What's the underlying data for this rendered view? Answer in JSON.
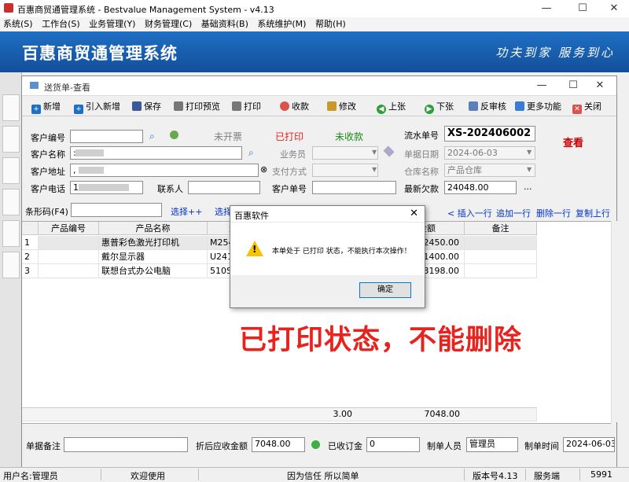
{
  "outer_window": {
    "title": "百惠商贸通管理系统 - Bestvalue Management System - v4.13",
    "minimize": "—",
    "maximize": "☐",
    "close": "✕"
  },
  "menubar": [
    "系统(S)",
    "工作台(S)",
    "业务管理(Y)",
    "财务管理(C)",
    "基础资料(B)",
    "系统维护(M)",
    "帮助(H)"
  ],
  "banner": {
    "app_name": "百惠商贸通管理系统",
    "slogan": "功夫到家 服务到心"
  },
  "inner_window": {
    "title": "送货单-查看",
    "minimize": "—",
    "maximize": "☐",
    "close": "✕"
  },
  "toolbar": {
    "new": "新增",
    "import_new": "引入新增",
    "save": "保存",
    "print_preview": "打印预览",
    "print": "打印",
    "collect": "收款",
    "modify": "修改",
    "prev": "上张",
    "next": "下张",
    "unaudit": "反审核",
    "more": "更多功能",
    "close": "关闭"
  },
  "form": {
    "customer_code_label": "客户编号",
    "customer_code": "",
    "invoice_status": "未开票",
    "print_status": "已打印",
    "collect_status": "未收款",
    "serial_label": "流水单号",
    "serial": "XS-202406002",
    "mode": "查看",
    "customer_name_label": "客户名称",
    "customer_name": ":",
    "salesman_label": "业务员",
    "salesman": "",
    "date_label": "单据日期",
    "date": "2024-06-03",
    "address_label": "客户地址",
    "address": ",",
    "pay_label": "支付方式",
    "pay": "",
    "warehouse_label": "仓库名称",
    "warehouse": "产品仓库",
    "phone_label": "客户电话",
    "phone": "1",
    "contact_label": "联系人",
    "contact": "",
    "cust_order_label": "客户单号",
    "cust_order": "",
    "debt_label": "最新欠款",
    "debt": "24048.00",
    "more_dots": "..."
  },
  "barcode_bar": {
    "label": "条形码(F4)",
    "select": "选择++",
    "select_product": "选择产",
    "insert_row": "< 插入一行",
    "append_row": "追加一行",
    "delete_row": "删除一行",
    "copy_row": "复制上行"
  },
  "grid": {
    "headers": [
      "产品编号",
      "产品名称",
      "型号",
      "金额",
      "备注"
    ],
    "rows": [
      {
        "no": "1",
        "code": "",
        "name": "惠普彩色激光打印机",
        "model": "M254",
        "amount": "2450.00"
      },
      {
        "no": "2",
        "code": "",
        "name": "戴尔显示器",
        "model": "U241",
        "amount": "1400.00"
      },
      {
        "no": "3",
        "code": "",
        "name": "联想台式办公电脑",
        "model": "510S",
        "amount": "3198.00"
      }
    ],
    "total_qty": "3.00",
    "total_amount": "7048.00"
  },
  "footer": {
    "remark_label": "单据备注",
    "remark": "",
    "discount_label": "折后应收金额",
    "discount": "7048.00",
    "deposit_label": "已收订金",
    "deposit": "0",
    "maker_label": "制单人员",
    "maker": "管理员",
    "time_label": "制单时间",
    "time": "2024-06-03"
  },
  "dialog": {
    "title": "百惠软件",
    "close": "✕",
    "message": "本单处于 已打印 状态，不能执行本次操作！",
    "ok": "确定"
  },
  "overlay_text": "已打印状态，不能删除",
  "statusbar": {
    "user": "用户名:管理员",
    "welcome": "欢迎使用",
    "motto": "因为信任 所以简单",
    "version": "版本号4.13",
    "client": "服务端",
    "code": "5991"
  },
  "colors": {
    "banner": "#1f6fc4",
    "print_status": "#e8221d",
    "collect_status": "#1a8c1a",
    "mode": "#cc0000",
    "overlay": "#e8221d",
    "link": "#0033cc"
  }
}
